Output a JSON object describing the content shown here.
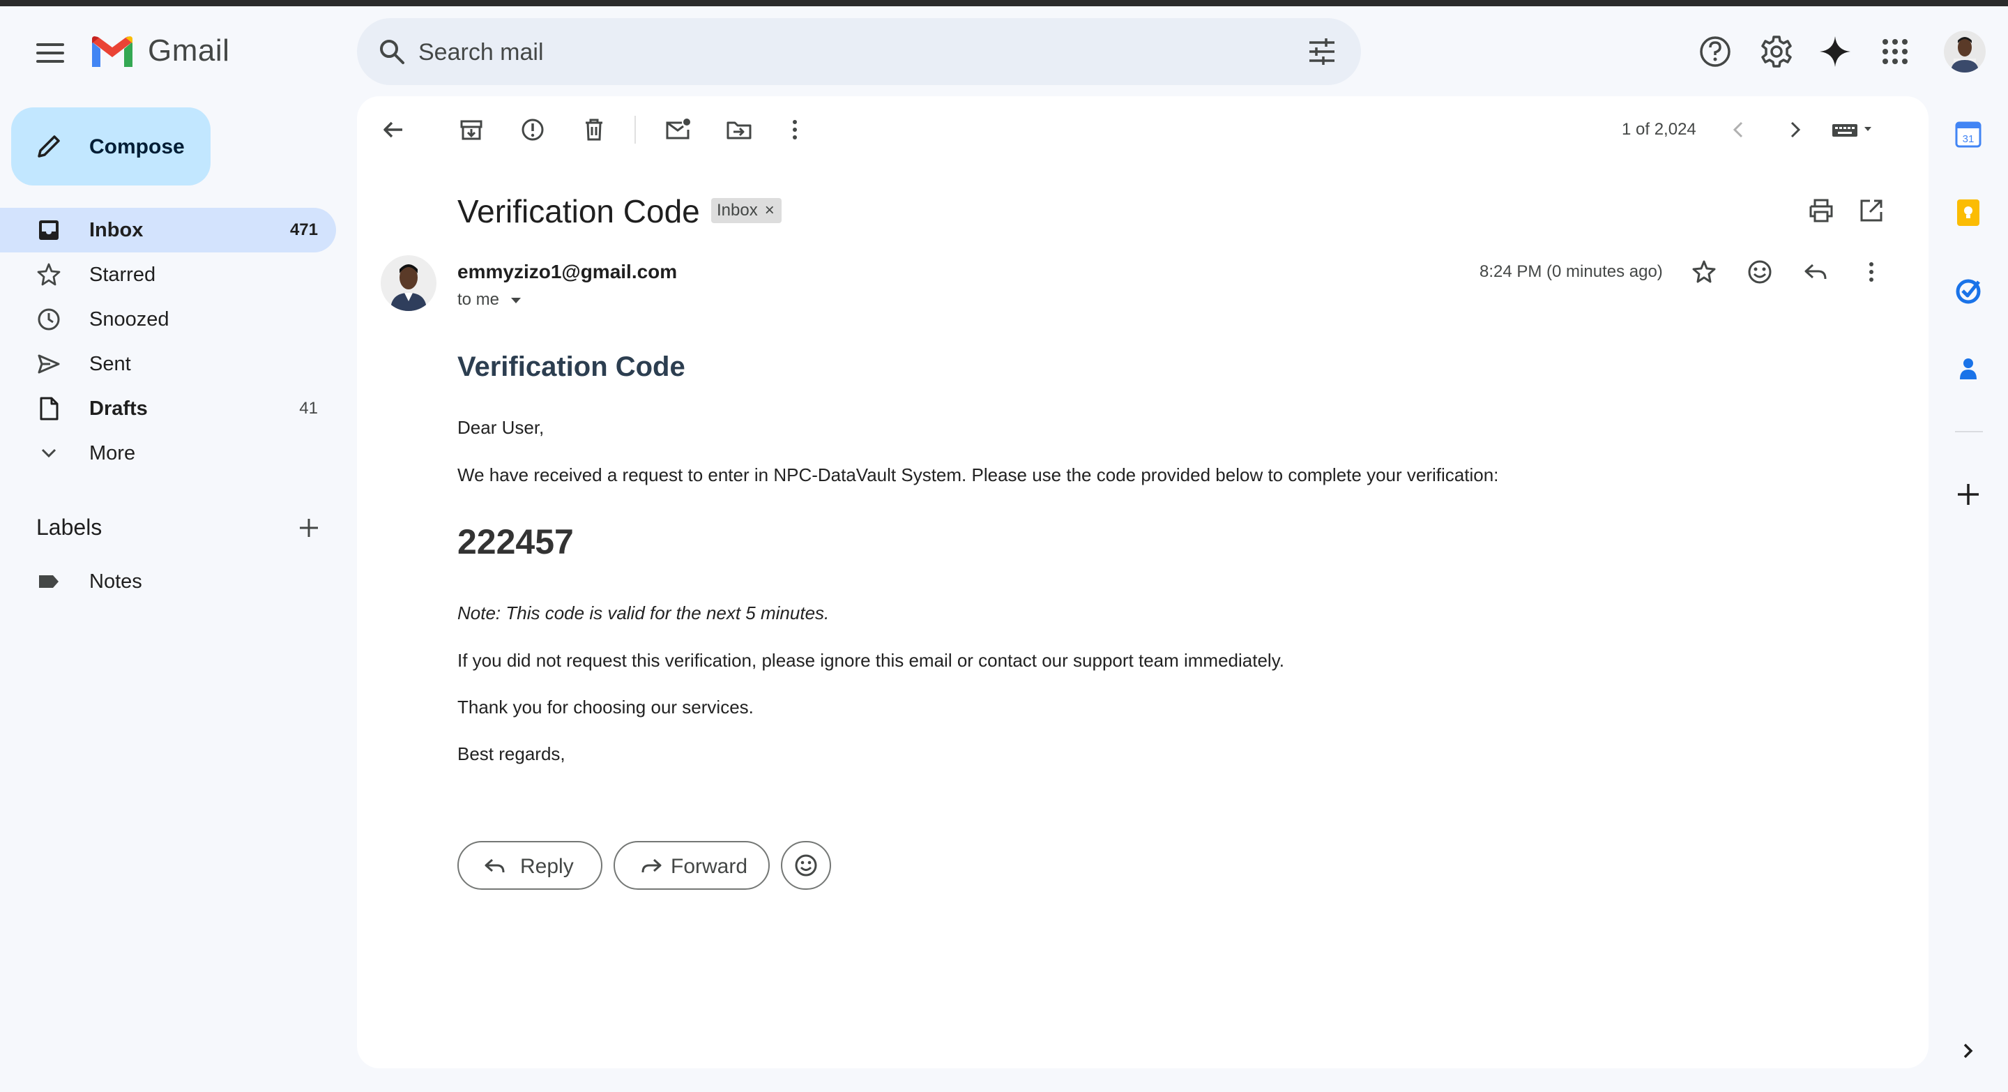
{
  "app": {
    "name": "Gmail"
  },
  "search": {
    "placeholder": "Search mail"
  },
  "sidebar": {
    "compose_label": "Compose",
    "items": [
      {
        "label": "Inbox",
        "count": "471"
      },
      {
        "label": "Starred",
        "count": ""
      },
      {
        "label": "Snoozed",
        "count": ""
      },
      {
        "label": "Sent",
        "count": ""
      },
      {
        "label": "Drafts",
        "count": "41"
      },
      {
        "label": "More",
        "count": ""
      }
    ],
    "labels_heading": "Labels",
    "labels": [
      {
        "label": "Notes"
      }
    ]
  },
  "toolbar": {
    "pager": "1 of 2,024"
  },
  "email": {
    "subject": "Verification Code",
    "chip": "Inbox",
    "chip_close": "×",
    "sender": "emmyzizo1@gmail.com",
    "to": "to me",
    "time": "8:24 PM (0 minutes ago)",
    "body": {
      "title": "Verification Code",
      "greeting": "Dear User,",
      "intro": "We have received a request to enter in NPC-DataVault System. Please use the code provided below to complete your verification:",
      "code": "222457",
      "note": "Note: This code is valid for the next 5 minutes.",
      "warning": "If you did not request this verification, please ignore this email or contact our support team immediately.",
      "thanks": "Thank you for choosing our services.",
      "signoff": "Best regards,"
    },
    "actions": {
      "reply": "Reply",
      "forward": "Forward"
    }
  },
  "icons": [
    "menu-icon",
    "search-icon",
    "tune-icon",
    "help-icon",
    "settings-icon",
    "gemini-icon",
    "apps-icon",
    "back-icon",
    "archive-icon",
    "report-spam-icon",
    "delete-icon",
    "mark-unread-icon",
    "move-to-icon",
    "more-vert-icon",
    "chevron-left-icon",
    "chevron-right-icon",
    "keyboard-icon",
    "print-icon",
    "open-in-new-icon",
    "star-icon",
    "emoji-icon",
    "reply-icon",
    "forward-icon",
    "calendar-icon",
    "keep-icon",
    "tasks-icon",
    "contacts-icon",
    "add-icon"
  ],
  "colors": {
    "accent": "#0b57d0",
    "compose_bg": "#c2e7ff",
    "active_nav": "#d3e3fd",
    "bg": "#f6f8fc"
  }
}
